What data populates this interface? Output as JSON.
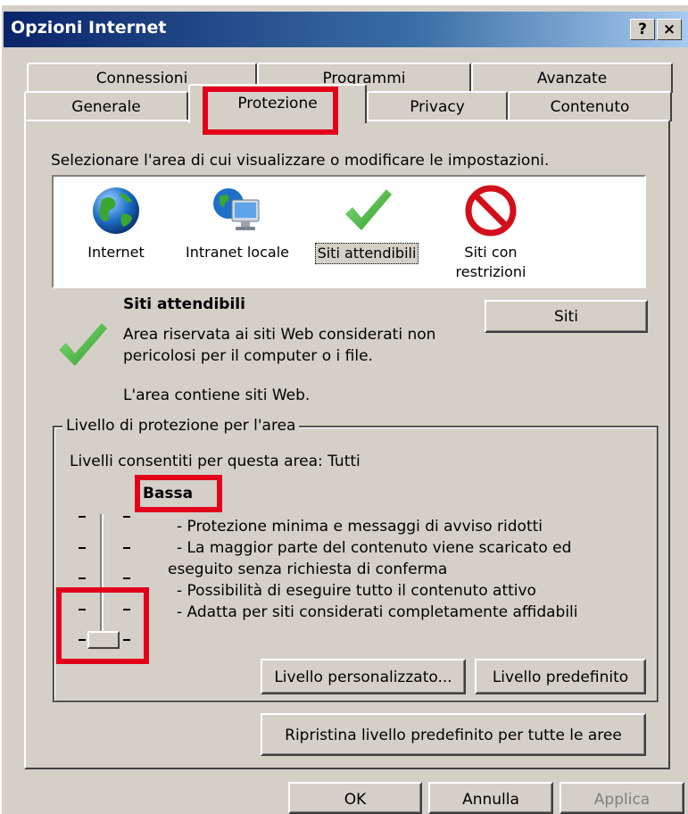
{
  "window": {
    "title": "Opzioni Internet",
    "help_label": "?",
    "close_label": "×"
  },
  "tabs": {
    "row1": [
      "Connessioni",
      "Programmi",
      "Avanzate"
    ],
    "row2": [
      "Generale",
      "Protezione",
      "Privacy",
      "Contenuto"
    ]
  },
  "zones": {
    "instruction": "Selezionare l'area di cui visualizzare o modificare le impostazioni.",
    "items": [
      {
        "label": "Internet",
        "icon": "globe-icon"
      },
      {
        "label": "Intranet locale",
        "icon": "intranet-computer-icon"
      },
      {
        "label": "Siti attendibili",
        "icon": "checkmark-icon",
        "selected": true
      },
      {
        "label": "Siti con restrizioni",
        "label_line1": "Siti con",
        "label_line2": "restrizioni",
        "icon": "no-entry-icon"
      }
    ]
  },
  "zone_info": {
    "title": "Siti attendibili",
    "desc_line1": "Area riservata ai siti Web considerati non",
    "desc_line2": "pericolosi per il computer o i file.",
    "contains": "L'area contiene siti Web.",
    "sites_button": "Siti"
  },
  "security_level": {
    "group_label": "Livello di protezione per l'area",
    "allowed": "Livelli consentiti per questa area: Tutti",
    "level_name": "Bassa",
    "slider_level": 0,
    "slider_max": 4,
    "bullets": [
      "- Protezione minima e messaggi di avviso ridotti",
      "- La maggior parte del contenuto viene scaricato ed",
      "eseguito senza richiesta di conferma",
      "- Possibilità di eseguire tutto il contenuto attivo",
      "- Adatta per siti considerati completamente affidabili"
    ],
    "custom_button": "Livello personalizzato...",
    "default_button": "Livello predefinito"
  },
  "reset_button": "Ripristina livello predefinito per tutte le aree",
  "footer": {
    "ok": "OK",
    "cancel": "Annulla",
    "apply": "Applica"
  },
  "colors": {
    "highlight": "#e3001b",
    "dialog_bg": "#d4d0c8",
    "title_bar": "#0a246a"
  }
}
